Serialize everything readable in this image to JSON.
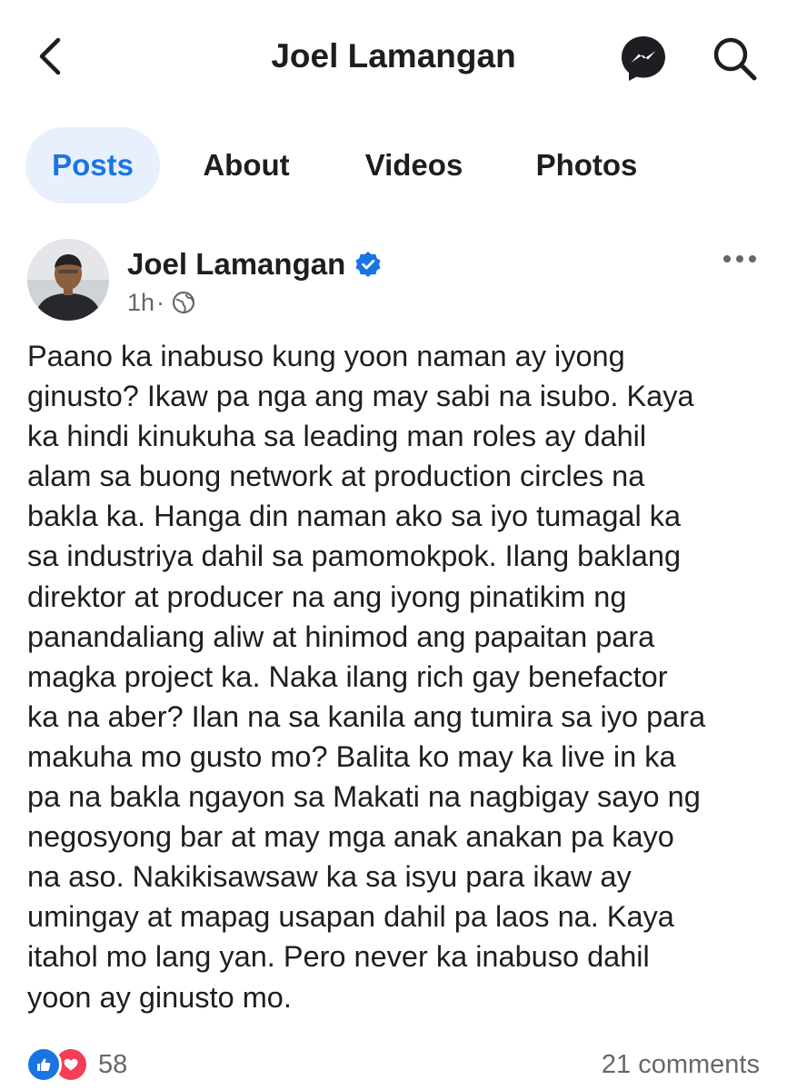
{
  "header": {
    "title": "Joel Lamangan",
    "back_icon": "chevron-left-icon",
    "messenger_icon": "messenger-icon",
    "search_icon": "search-icon"
  },
  "tabs": [
    {
      "label": "Posts",
      "active": true
    },
    {
      "label": "About",
      "active": false
    },
    {
      "label": "Videos",
      "active": false
    },
    {
      "label": "Photos",
      "active": false
    }
  ],
  "post": {
    "author": "Joel Lamangan",
    "verified": true,
    "time": "1h",
    "privacy_icon": "globe-icon",
    "body_lines": [
      "Paano ka inabuso kung yoon naman ay iyong",
      "ginusto? Ikaw pa nga ang may sabi na isubo. Kaya",
      "ka hindi kinukuha sa leading man roles ay dahil",
      "alam sa buong network at production circles na",
      "bakla ka. Hanga din naman ako sa iyo tumagal ka",
      "sa industriya dahil sa pamomokpok. Ilang baklang",
      "direktor at producer na ang iyong pinatikim ng",
      "panandaliang aliw at hinimod ang papaitan para",
      "magka project ka. Naka ilang rich gay benefactor",
      "ka na aber? Ilan na sa kanila ang tumira sa iyo para",
      "makuha mo gusto mo? Balita ko may ka live in ka",
      "pa na bakla ngayon sa Makati na nagbigay sayo ng",
      "negosyong bar at may mga anak anakan pa kayo",
      "na aso. Nakikisawsaw ka sa isyu para ikaw ay",
      "umingay at mapag usapan dahil pa laos na. Kaya",
      "itahol mo lang yan. Pero never ka inabuso dahil",
      "yoon ay ginusto mo."
    ],
    "reaction_count": "58",
    "comments": "21 comments"
  },
  "colors": {
    "accent": "#1b74e4",
    "tab_active_bg": "#e7f0fc",
    "love": "#f33e58",
    "text": "#1c1e21",
    "secondary_text": "#65676b"
  }
}
